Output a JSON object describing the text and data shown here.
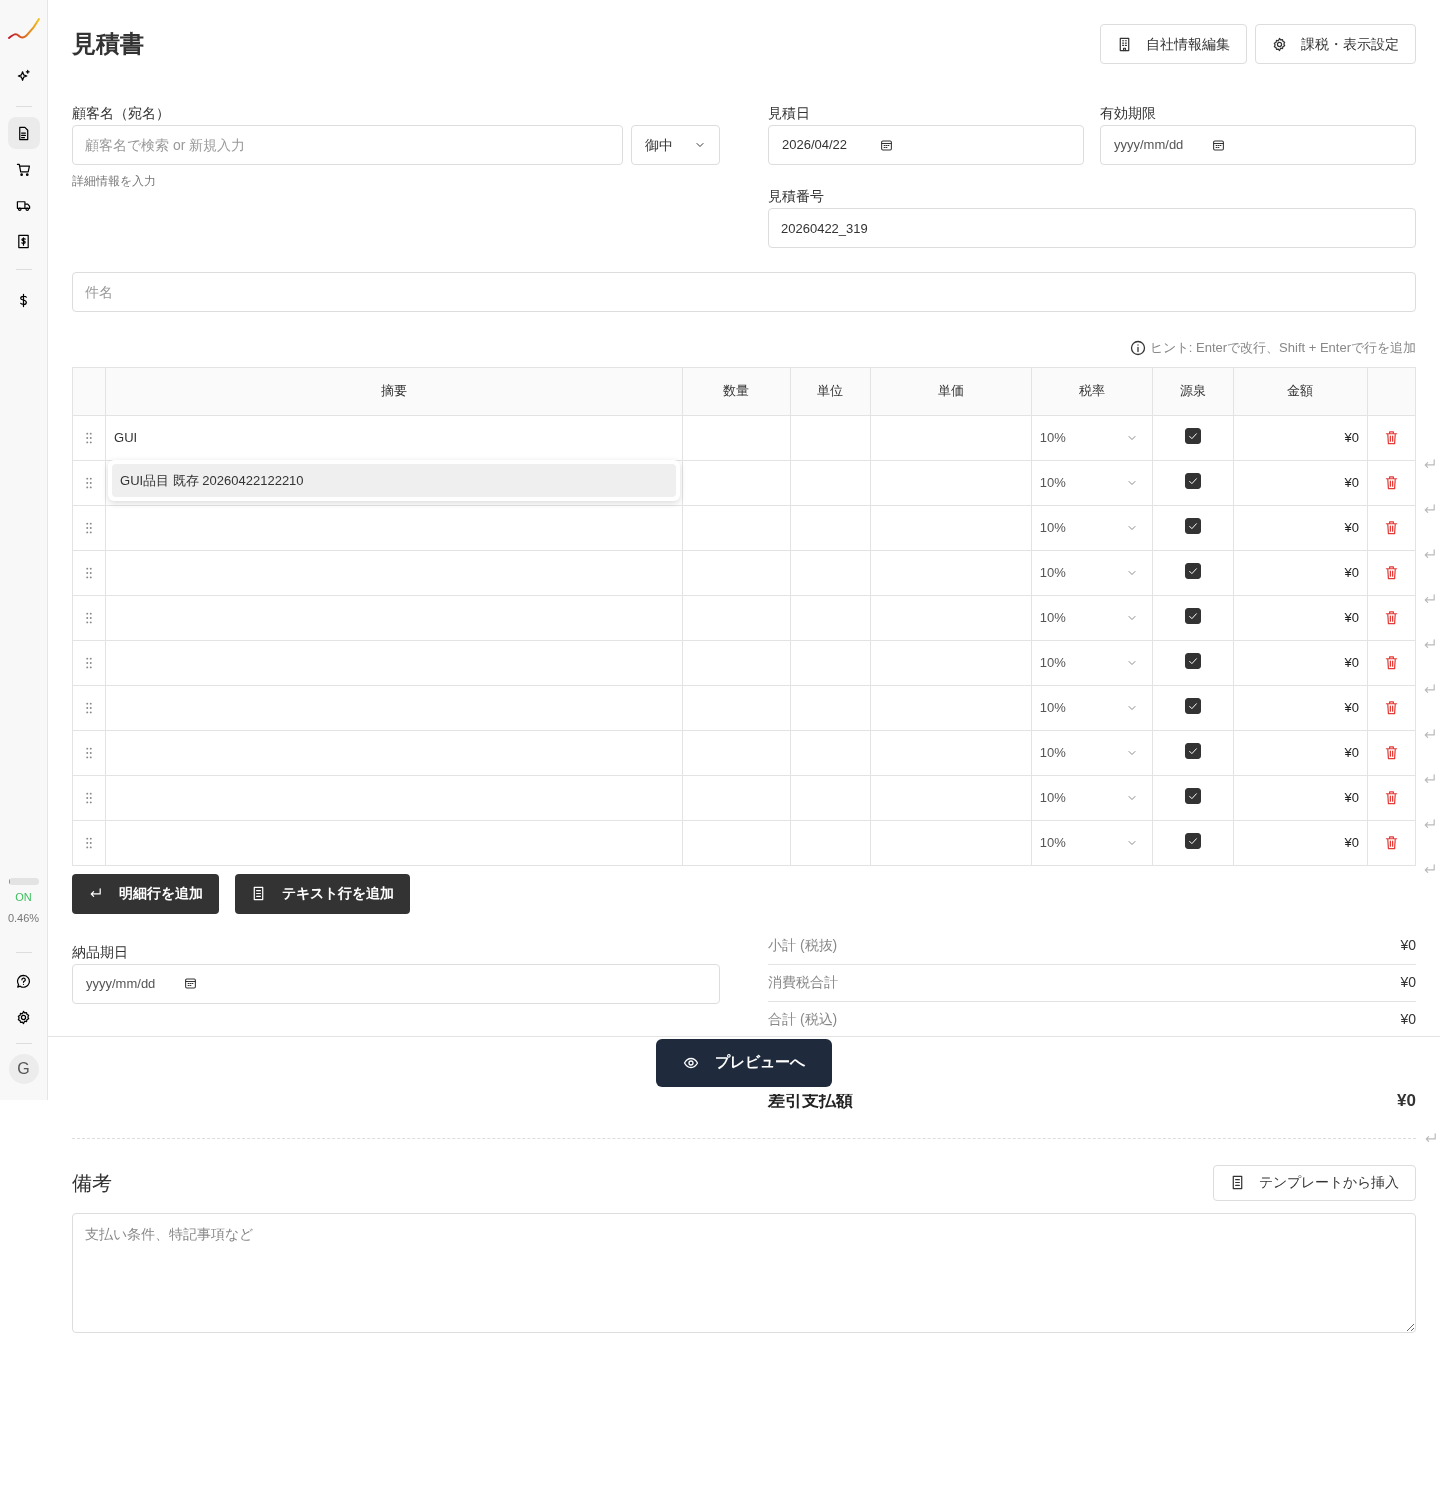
{
  "sidebar": {
    "nav": [
      {
        "selected": false
      },
      {
        "selected": true
      },
      {
        "selected": false
      },
      {
        "selected": false
      },
      {
        "selected": false
      },
      {
        "selected": false
      }
    ],
    "usage": {
      "level": 0.03,
      "status": "ON",
      "reading": "0.46%"
    },
    "avatar": "G"
  },
  "header": {
    "title": "見積書",
    "buttons": [
      "自社情報編集",
      "課税・表示設定"
    ]
  },
  "customer": {
    "label": "顧客名（宛名）",
    "placeholder": "顧客名で検索 or 新規入力",
    "honorific": "御中",
    "details_link": "詳細情報を入力"
  },
  "quote_date": {
    "label": "見積日",
    "value": "2026/04/22"
  },
  "valid_until": {
    "label": "有効期限",
    "placeholder": "yyyy/mm/dd"
  },
  "quote_number": {
    "label": "見積番号",
    "value": "20260422_319"
  },
  "subject": {
    "placeholder": "件名"
  },
  "hint": "ヒント: Enterで改行、Shift + Enterで行を追加",
  "table": {
    "columns": [
      "摘要",
      "数量",
      "単位",
      "単価",
      "税率",
      "源泉",
      "金額"
    ],
    "rows": [
      {
        "description": "GUI",
        "tax_rate": "10%",
        "withholding": true,
        "amount": "¥0"
      },
      {
        "tax_rate": "10%",
        "withholding": true,
        "amount": "¥0"
      },
      {
        "tax_rate": "10%",
        "withholding": true,
        "amount": "¥0"
      },
      {
        "tax_rate": "10%",
        "withholding": true,
        "amount": "¥0"
      },
      {
        "tax_rate": "10%",
        "withholding": true,
        "amount": "¥0"
      },
      {
        "tax_rate": "10%",
        "withholding": true,
        "amount": "¥0"
      },
      {
        "tax_rate": "10%",
        "withholding": true,
        "amount": "¥0"
      },
      {
        "tax_rate": "10%",
        "withholding": true,
        "amount": "¥0"
      },
      {
        "tax_rate": "10%",
        "withholding": true,
        "amount": "¥0"
      },
      {
        "tax_rate": "10%",
        "withholding": true,
        "amount": "¥0"
      }
    ]
  },
  "suggestion": "GUI品目 既存 20260422122210",
  "add_buttons": [
    "明細行を追加",
    "テキスト行を追加"
  ],
  "delivery_date": {
    "label": "納品期日",
    "placeholder": "yyyy/mm/dd"
  },
  "totals": [
    {
      "label": "小計 (税抜)",
      "value": "¥0",
      "kind": "line"
    },
    {
      "label": "消費税合計",
      "value": "¥0",
      "kind": "line"
    },
    {
      "label": "合計 (税込)",
      "value": "¥0",
      "kind": "line"
    },
    {
      "label": "差引支払額",
      "value": "¥0",
      "kind": "grand"
    }
  ],
  "notes": {
    "title": "備考",
    "template_button": "テンプレートから挿入",
    "placeholder": "支払い条件、特記事項など"
  },
  "footer": {
    "preview_button": "プレビューへ"
  }
}
